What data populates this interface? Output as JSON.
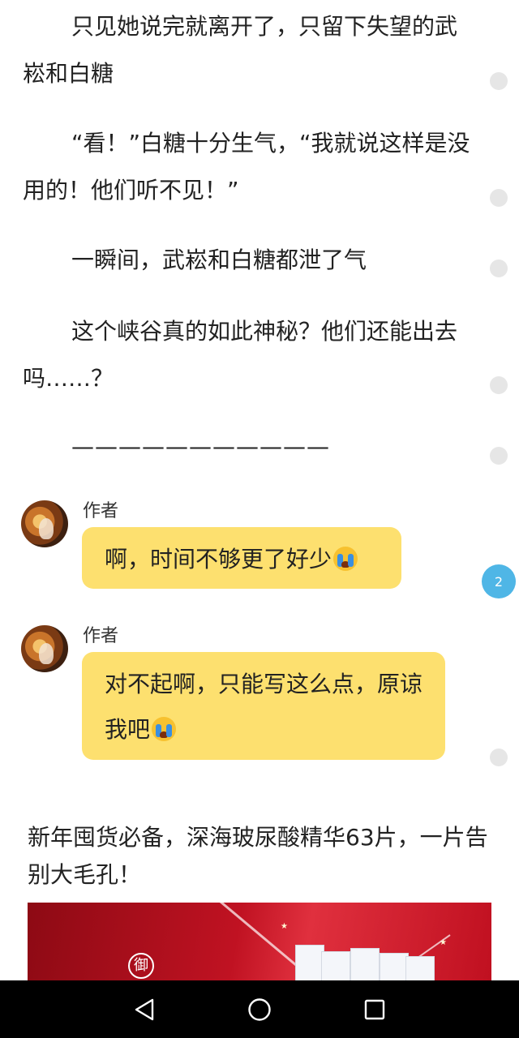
{
  "story": {
    "paragraphs": [
      "只见她说完就离开了，只留下失望的武崧和白糖",
      "“看！”白糖十分生气，“我就说这样是没用的！他们听不见！”",
      "一瞬间，武崧和白糖都泄了气",
      "这个峡谷真的如此神秘？他们还能出去吗……？",
      "———————————"
    ]
  },
  "author_notes": [
    {
      "name": "作者",
      "text": "啊，时间不够更了好少",
      "emoji": "loudly-crying-face"
    },
    {
      "name": "作者",
      "text": "对不起啊，只能写这么点，原谅我吧",
      "emoji": "loudly-crying-face"
    }
  ],
  "comment_badge": {
    "count": "2"
  },
  "ad": {
    "text": "新年囤货必备，深海玻尿酸精华63片，一片告别大毛孔！",
    "logo_char": "御"
  },
  "colors": {
    "bubble": "#fde06f",
    "badge": "#4fb6e6",
    "comment_dot": "#e6e6e6",
    "ad_red": "#c01222"
  },
  "nav": {
    "icons": [
      "back-icon",
      "home-icon",
      "recents-icon"
    ]
  }
}
